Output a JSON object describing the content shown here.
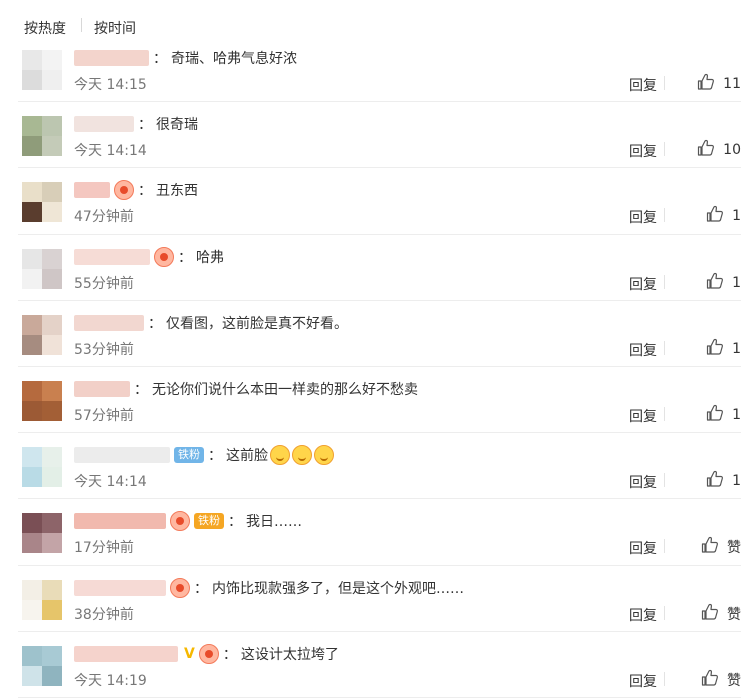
{
  "sort_bar": {
    "hot": "按热度",
    "time": "按时间"
  },
  "labels": {
    "reply": "回复",
    "like_zero": "赞"
  },
  "comments": [
    {
      "text": "奇瑞、哈弗气息好浓",
      "time": "今天 14:15",
      "likes": "11",
      "avatar": [
        "#e8e8e8",
        "#f3f3f3",
        "#dcdcdc",
        "#efefef"
      ],
      "name_color": "#f3d4cc",
      "name_width": 75
    },
    {
      "text": "很奇瑞",
      "time": "今天 14:14",
      "likes": "10",
      "avatar": [
        "#a8b893",
        "#bcc6b0",
        "#8f9c7a",
        "#c4cbb8"
      ],
      "name_color": "#f1e3df",
      "name_width": 60
    },
    {
      "text": "丑东西",
      "time": "47分钟前",
      "likes": "1",
      "avatar": [
        "#e9dfc9",
        "#d8ceb8",
        "#5a3d2e",
        "#efe6d6"
      ],
      "name_color": "#f4c7c0",
      "name_width": 36,
      "vip": true
    },
    {
      "text": "哈弗",
      "time": "55分钟前",
      "likes": "1",
      "avatar": [
        "#e6e6e6",
        "#d9d2d2",
        "#f2f2f2",
        "#cfc6c6"
      ],
      "name_color": "#f6dcd6",
      "name_width": 76,
      "vip": true
    },
    {
      "text": "仅看图，这前脸是真不好看。",
      "time": "53分钟前",
      "likes": "1",
      "avatar": [
        "#c9a99a",
        "#e4d2c8",
        "#a68c80",
        "#f0e2d8"
      ],
      "name_color": "#f2d7d0",
      "name_width": 70
    },
    {
      "text": "无论你们说什么本田一样卖的那么好不愁卖",
      "time": "57分钟前",
      "likes": "1",
      "avatar": [
        "#b56a3e",
        "#c9804f",
        "#9c5a35",
        "#a35f36"
      ],
      "name_color": "#f2d0c8",
      "name_width": 56
    },
    {
      "text": "这前脸",
      "time": "今天 14:14",
      "likes": "1",
      "avatar": [
        "#cfe6ee",
        "#e7f0ea",
        "#b9dbe6",
        "#e3efe7"
      ],
      "name_color": "#ececec",
      "name_width": 96,
      "tiefen": "铁粉",
      "tiefen_color": "blue",
      "emojis": 3
    },
    {
      "text": "我日……",
      "time": "17分钟前",
      "likes": "赞",
      "avatar": [
        "#7a4f55",
        "#8d6469",
        "#a98589",
        "#c3a4a7"
      ],
      "name_color": "#f1b9ae",
      "name_width": 92,
      "vip": true,
      "tiefen": "铁粉",
      "tiefen_color": "orange"
    },
    {
      "text": "内饰比现款强多了，但是这个外观吧……",
      "time": "38分钟前",
      "likes": "赞",
      "avatar": [
        "#f3efe6",
        "#e9dcb8",
        "#f7f4ee",
        "#e6c56a"
      ],
      "name_color": "#f6dad5",
      "name_width": 92,
      "vip": true
    },
    {
      "text": "这设计太拉垮了",
      "time": "今天 14:19",
      "likes": "赞",
      "avatar": [
        "#9ec2cc",
        "#a8cad4",
        "#cfe3e9",
        "#8fb4bf"
      ],
      "name_color": "#f5d3cc",
      "name_width": 104,
      "vmark": "V",
      "vip": true
    }
  ]
}
